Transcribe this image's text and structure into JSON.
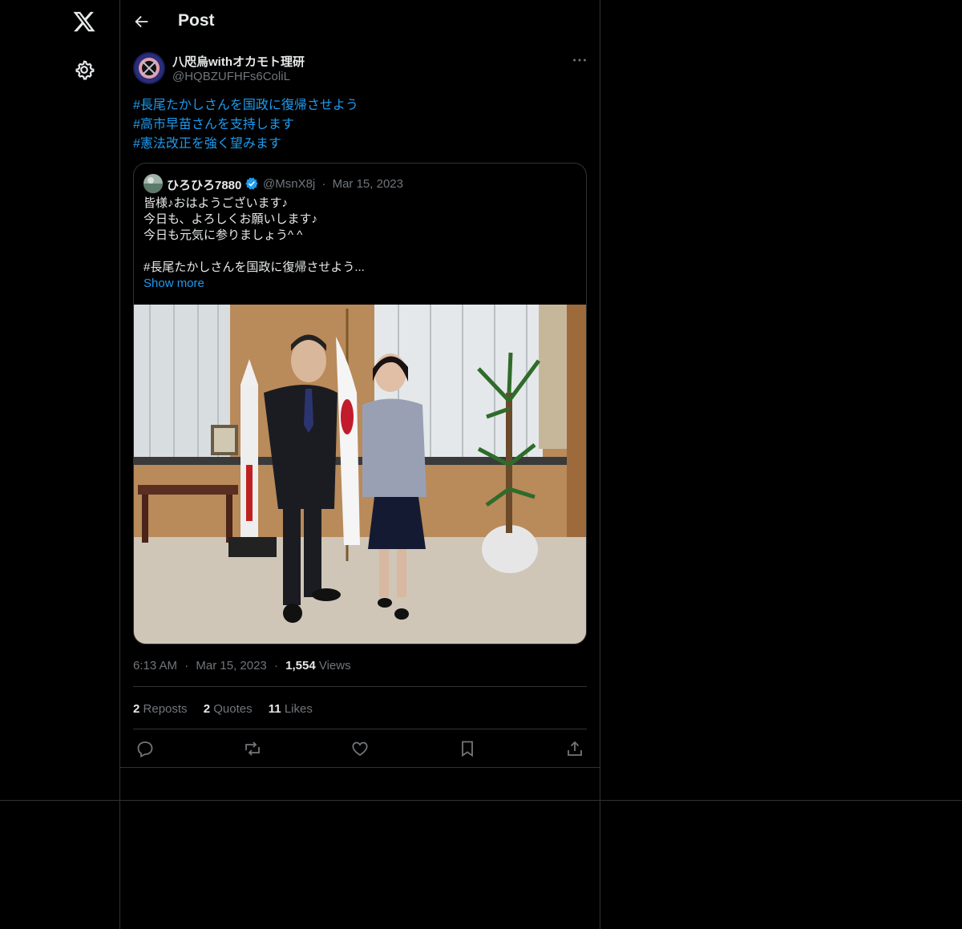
{
  "header": {
    "title": "Post"
  },
  "post": {
    "display_name": "八咫烏withオカモト理研",
    "handle": "@HQBZUFHFs6ColiL",
    "hashtags": [
      "#長尾たかしさんを国政に復帰させよう",
      "#高市早苗さんを支持します",
      "#憲法改正を強く望みます"
    ],
    "time": "6:13 AM",
    "date": "Mar 15, 2023",
    "views_count": "1,554",
    "views_label": "Views",
    "reposts_count": "2",
    "reposts_label": "Reposts",
    "quotes_count": "2",
    "quotes_label": "Quotes",
    "likes_count": "11",
    "likes_label": "Likes"
  },
  "quote": {
    "display_name": "ひろひろ7880",
    "handle": "@MsnX8j",
    "separator": "·",
    "date": "Mar 15, 2023",
    "lines": [
      "皆様♪おはようございます♪",
      "今日も、よろしくお願いします♪",
      "今日も元気に参りましょう^ ^",
      "",
      "#長尾たかしさんを国政に復帰させよう..."
    ],
    "show_more": "Show more"
  },
  "icons": [
    "x-logo-icon",
    "gear-icon",
    "back-arrow-icon",
    "more-icon",
    "verified-icon",
    "reply-icon",
    "repost-icon",
    "like-icon",
    "bookmark-icon",
    "share-icon"
  ],
  "colors": {
    "background": "#000000",
    "text": "#e7e9ea",
    "muted": "#71767b",
    "link": "#1d9bf0",
    "border": "#2f3336"
  }
}
